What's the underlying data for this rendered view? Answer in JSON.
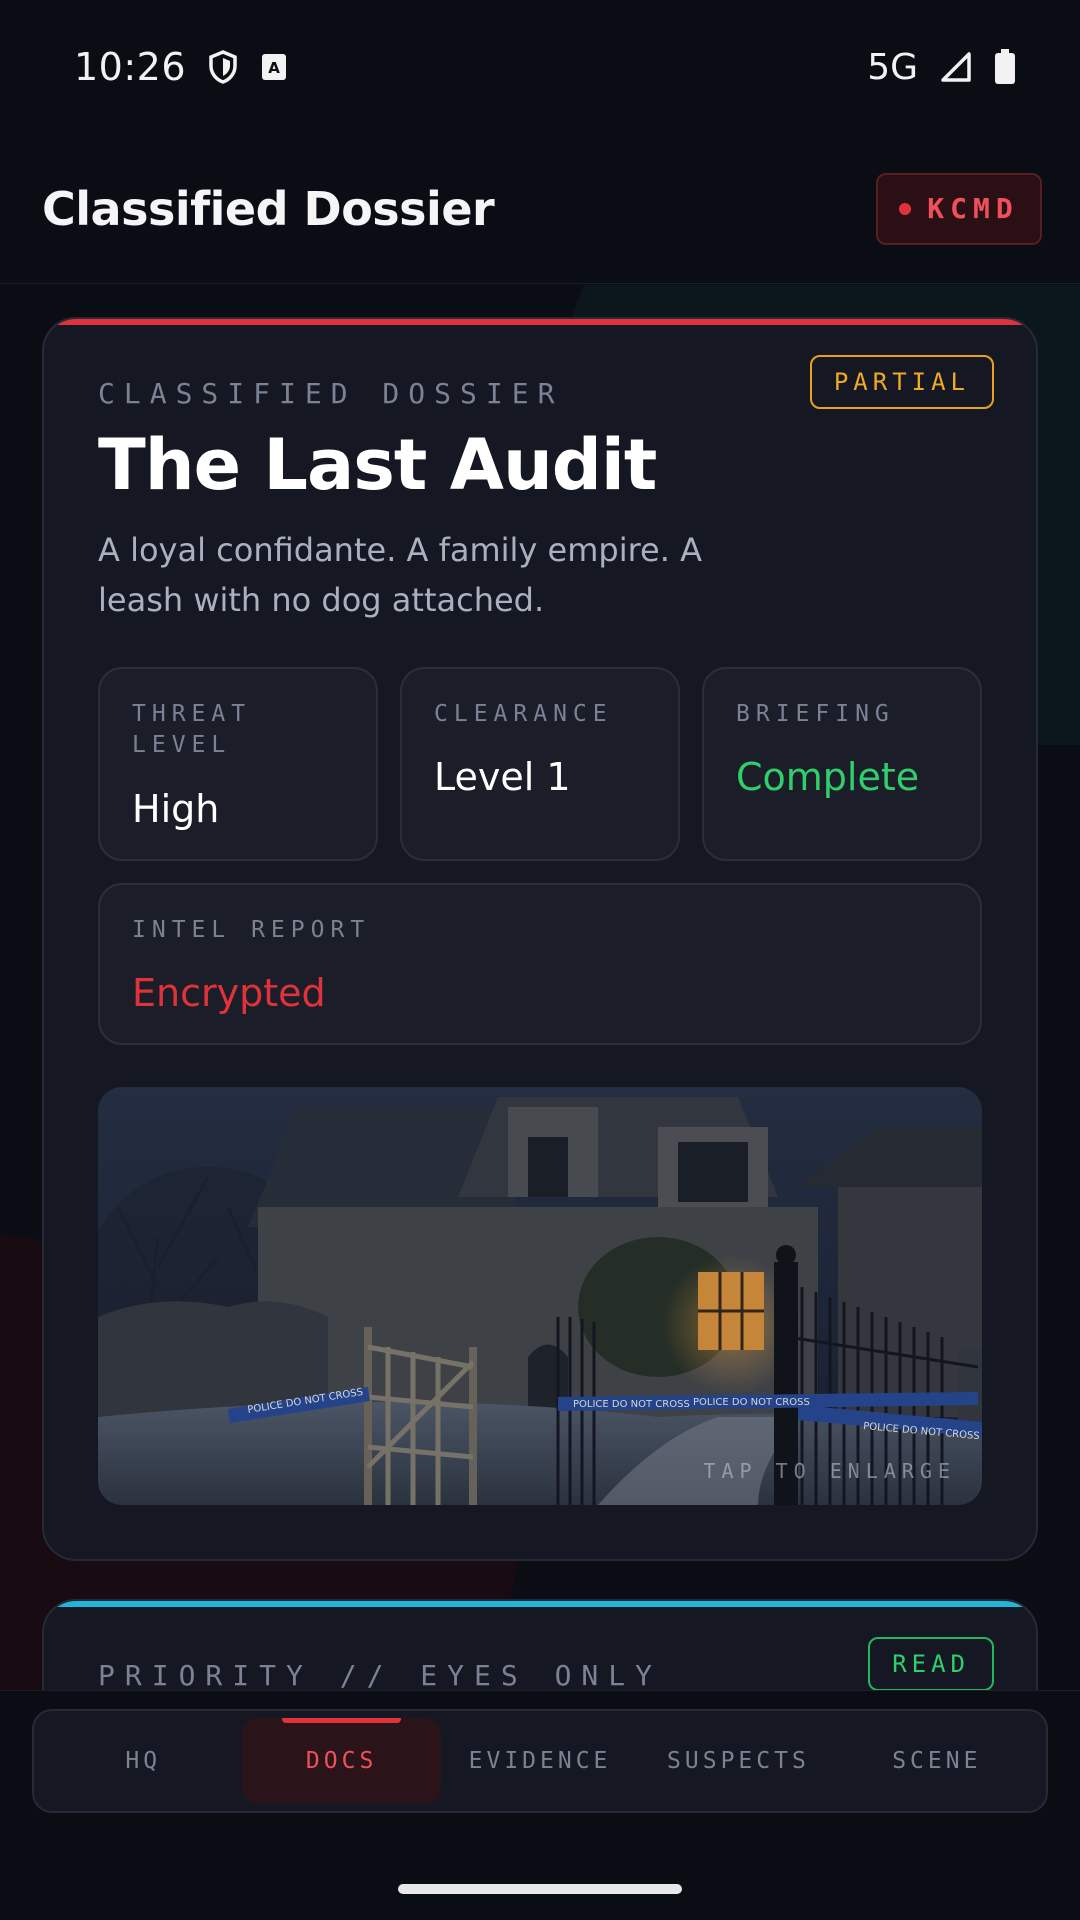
{
  "status_bar": {
    "time": "10:26",
    "network": "5G",
    "icons": [
      "shield-icon",
      "keyboard-a-icon",
      "signal-icon",
      "battery-icon"
    ]
  },
  "app_bar": {
    "title": "Classified Dossier",
    "user_badge": "KCMD"
  },
  "dossier": {
    "eyebrow": "CLASSIFIED DOSSIER",
    "status": "PARTIAL",
    "title": "The Last Audit",
    "summary": "A loyal confidante. A family empire. A leash with no dog attached.",
    "stats": {
      "threat": {
        "label": "THREAT LEVEL",
        "value": "High"
      },
      "clearance": {
        "label": "CLEARANCE",
        "value": "Level 1"
      },
      "briefing": {
        "label": "BRIEFING",
        "value": "Complete"
      },
      "intel": {
        "label": "INTEL REPORT",
        "value": "Encrypted"
      }
    },
    "image": {
      "tape_text": "POLICE DO NOT CROSS",
      "hint": "TAP TO ENLARGE"
    }
  },
  "second_card": {
    "eyebrow": "PRIORITY // EYES ONLY",
    "status": "READ"
  },
  "nav": {
    "items": [
      "HQ",
      "DOCS",
      "EVIDENCE",
      "SUSPECTS",
      "SCENE"
    ],
    "active": "DOCS"
  },
  "colors": {
    "accent_red": "#e0323a",
    "accent_cyan": "#22b5d6",
    "status_amber": "#f0a825",
    "status_green": "#2fcf6c",
    "background": "#0b0d14",
    "card": "#151823"
  }
}
